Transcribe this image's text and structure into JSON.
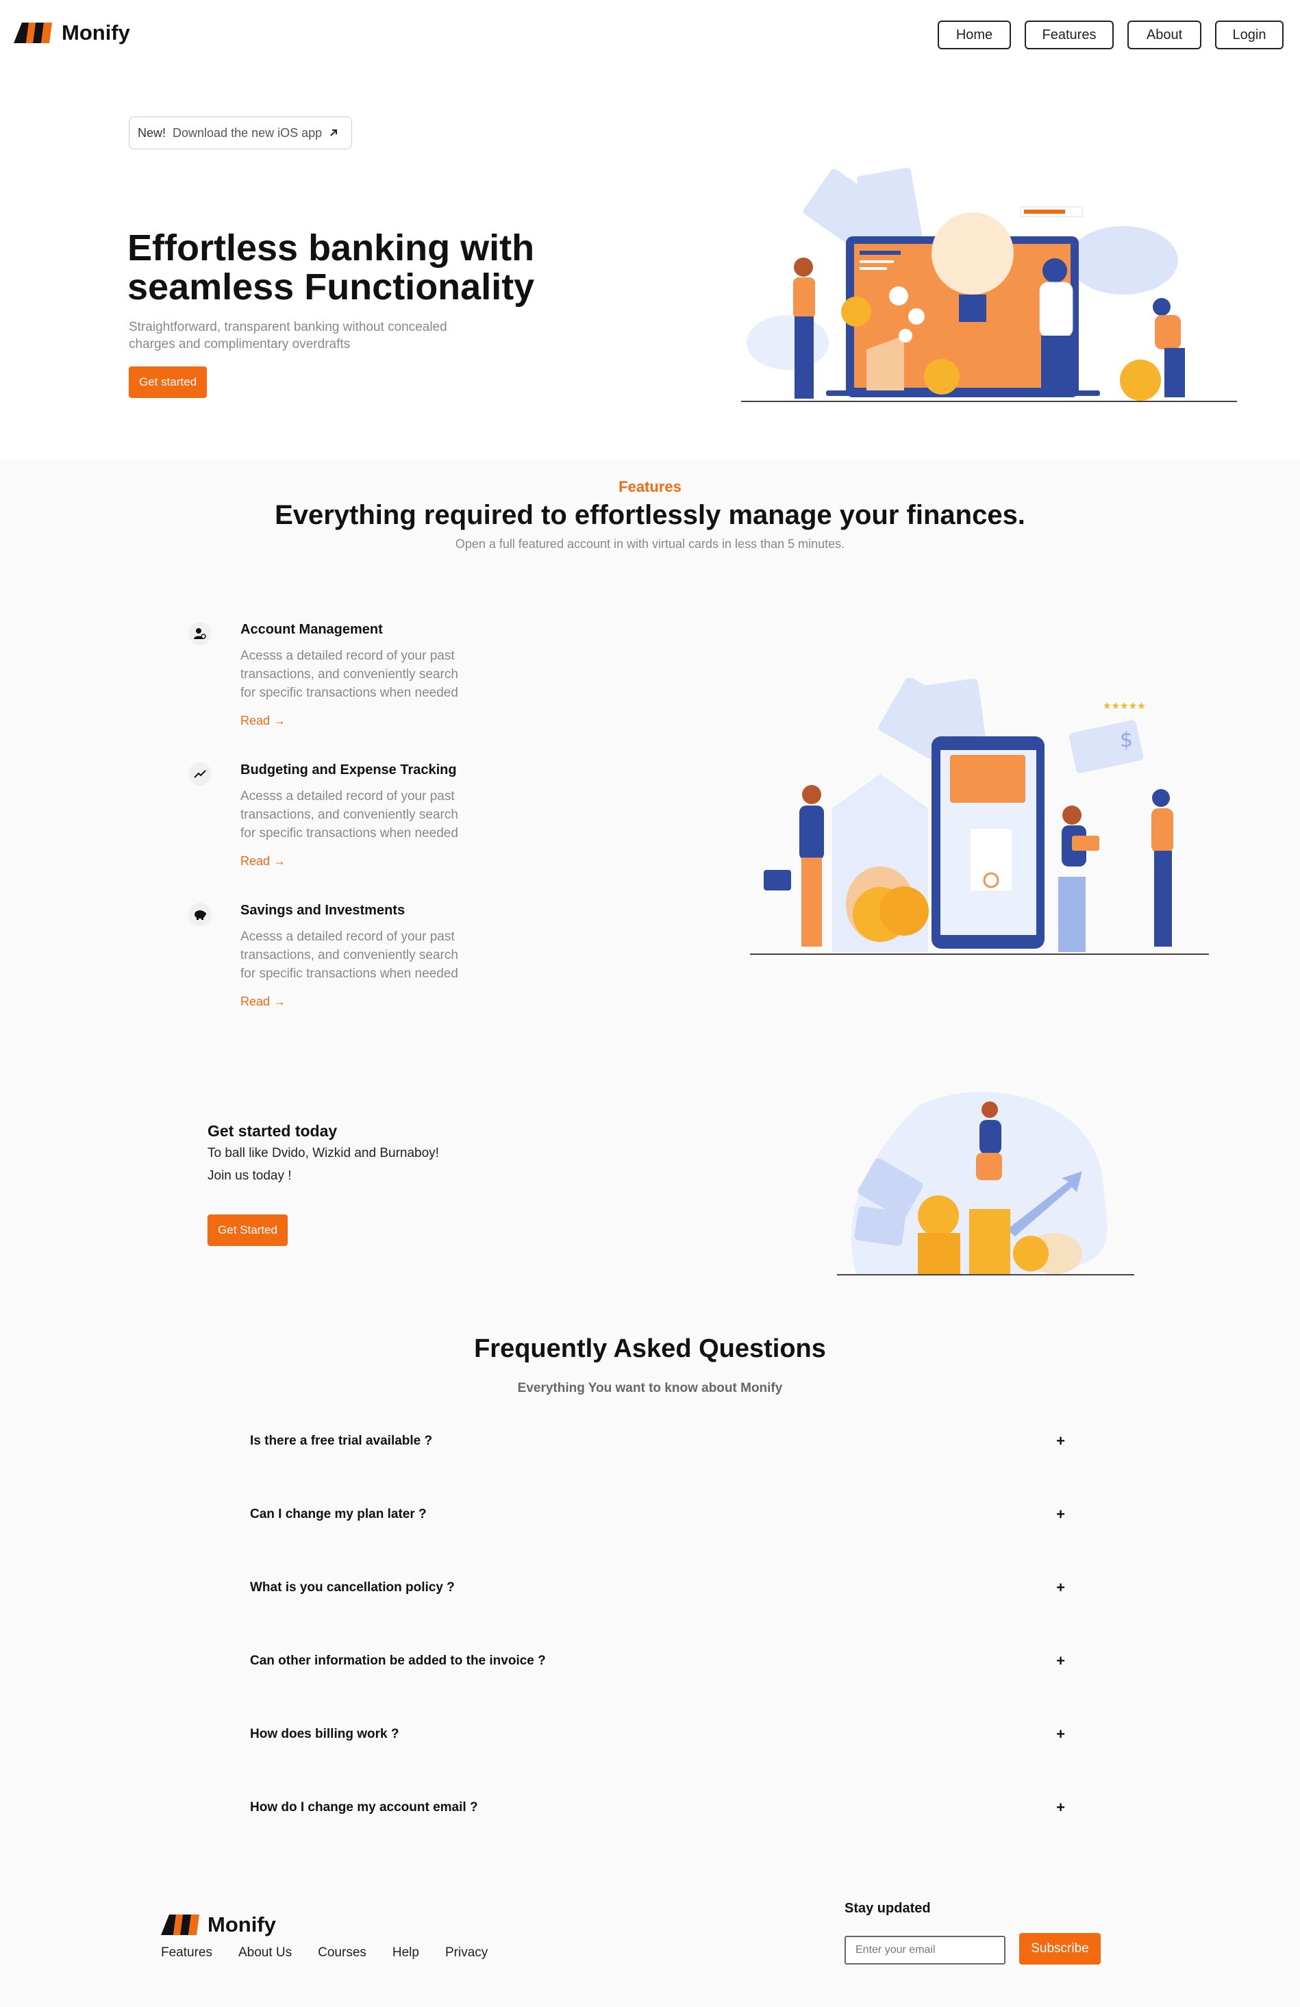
{
  "brand": {
    "name": "Monify",
    "accent": "#f26b10",
    "logo_colors": [
      "#111111",
      "#f26b10"
    ]
  },
  "nav": {
    "items": [
      "Home",
      "Features",
      "About",
      "Login"
    ]
  },
  "hero": {
    "badge_new": "New!",
    "badge_text": "Download the new iOS app",
    "badge_icon": "arrow-up-right-icon",
    "title_line1": "Effortless banking with",
    "title_line2": "seamless Functionality",
    "subtitle_line1": "Straightforward, transparent banking without concealed",
    "subtitle_line2": "charges and complimentary overdrafts",
    "cta": "Get started"
  },
  "features": {
    "kicker": "Features",
    "title": "Everything required to effortlessly manage your finances.",
    "subtitle": "Open a full featured account in with virtual cards in less than 5 minutes.",
    "items": [
      {
        "icon": "user-settings-icon",
        "title": "Account Management",
        "desc": [
          "Acesss a detailed record of your past",
          "transactions, and conveniently search",
          "for specific transactions when needed"
        ],
        "read": "Read →"
      },
      {
        "icon": "trending-up-icon",
        "title": "Budgeting and Expense Tracking",
        "desc": [
          "Acesss a detailed record of your past",
          "transactions, and conveniently search",
          "for specific transactions when needed"
        ],
        "read": "Read →"
      },
      {
        "icon": "piggy-bank-icon",
        "title": "Savings and Investments",
        "desc": [
          "Acesss a detailed record of your past",
          "transactions, and conveniently search",
          "for specific transactions when needed"
        ],
        "read": "Read →"
      }
    ]
  },
  "get_started": {
    "title": "Get started today",
    "line1": "To ball like Dvido, Wizkid and Burnaboy!",
    "line2": "Join us today !",
    "cta": "Get Started"
  },
  "faq": {
    "title": "Frequently Asked Questions",
    "subtitle": "Everything You want to know about Monify",
    "items": [
      "Is there a free trial available ?",
      "Can I change my plan later ?",
      "What is you cancellation policy ?",
      "Can other information be added to the invoice ?",
      "How does billing work ?",
      "How do I change my account email ?"
    ],
    "toggle": "+"
  },
  "footer": {
    "brand": "Monify",
    "links": [
      "Features",
      "About Us",
      "Courses",
      "Help",
      "Privacy"
    ],
    "stay_updated": "Stay updated",
    "email_placeholder": "Enter your email",
    "subscribe": "Subscribe"
  }
}
